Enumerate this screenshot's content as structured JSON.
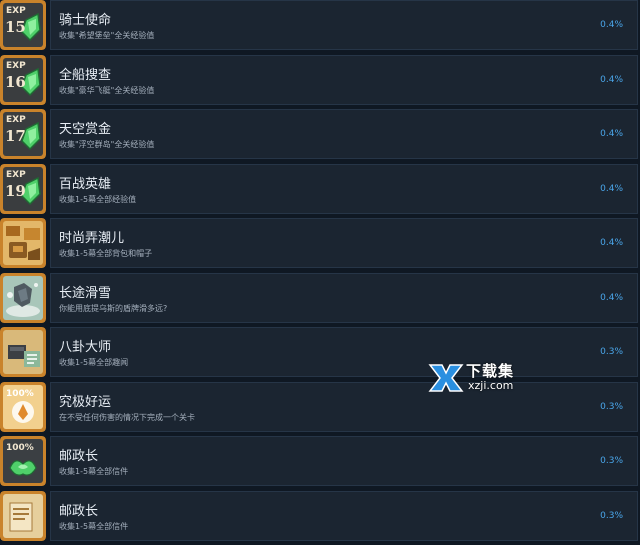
{
  "achievements": [
    {
      "icon": "exp-gem-icon",
      "badge": "15",
      "title": "骑士使命",
      "desc": "收集\"希望堡垒\"全关经验值",
      "percent": "0.4%"
    },
    {
      "icon": "exp-gem-icon",
      "badge": "16",
      "title": "全船搜查",
      "desc": "收集\"豪华飞艇\"全关经验值",
      "percent": "0.4%"
    },
    {
      "icon": "exp-gem-icon",
      "badge": "17",
      "title": "天空赏金",
      "desc": "收集\"浮空群岛\"全关经验值",
      "percent": "0.4%"
    },
    {
      "icon": "exp-gem-icon",
      "badge": "19",
      "title": "百战英雄",
      "desc": "收集1-5幕全部经验值",
      "percent": "0.4%"
    },
    {
      "icon": "backpack-hat-icon",
      "badge": "",
      "title": "时尚弄潮儿",
      "desc": "收集1-5幕全部背包和帽子",
      "percent": "0.4%"
    },
    {
      "icon": "shield-slide-icon",
      "badge": "",
      "title": "长途滑雪",
      "desc": "你能用底提乌斯的盾牌滑多远?",
      "percent": "0.4%"
    },
    {
      "icon": "gossip-chest-icon",
      "badge": "",
      "title": "八卦大师",
      "desc": "收集1-5幕全部趣闻",
      "percent": "0.3%"
    },
    {
      "icon": "lucky-100-icon",
      "badge": "100%",
      "title": "究极好运",
      "desc": "在不受任何伤害的情况下完成一个关卡",
      "percent": "0.3%"
    },
    {
      "icon": "mail-100-icon",
      "badge": "100%",
      "title": "邮政长",
      "desc": "收集1-5幕全部信件",
      "percent": "0.3%"
    },
    {
      "icon": "mail-scroll-icon",
      "badge": "",
      "title": "邮政长",
      "desc": "收集1-5幕全部信件",
      "percent": "0.3%"
    }
  ],
  "watermark": {
    "title": "下载集",
    "sub": "xzji.com"
  },
  "colors": {
    "panel": "#1b2531",
    "border": "#263547",
    "percent": "#4aa6ea",
    "background": "#0f1823"
  }
}
